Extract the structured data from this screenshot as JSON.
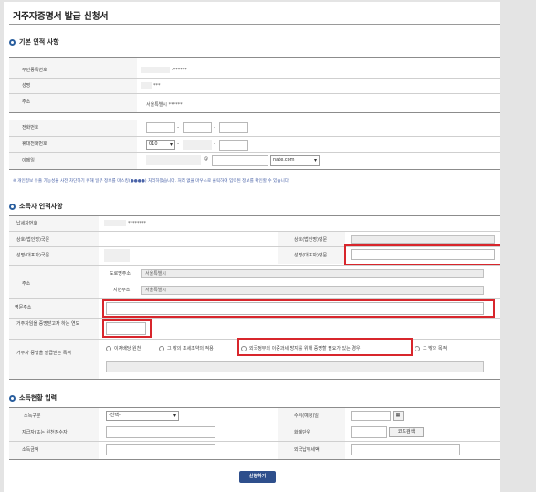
{
  "title": "거주자증명서 발급 신청서",
  "sections": {
    "basic": "기본 인적 사항",
    "income_person": "소득자 인적사항",
    "income_status": "소득현황 입력"
  },
  "basic": {
    "rrn_label": "주민등록번호",
    "rrn_value": "-******",
    "name_label": "성명",
    "name_value": "***",
    "address_label": "주소",
    "address_value": "서울특별시 ******",
    "phone_label": "전화번호",
    "mobile_label": "휴대전화번호",
    "mobile_prefix": "010",
    "email_label": "이메일",
    "email_at": "@",
    "email_domain": "nate.com"
  },
  "note": "※ 개인정보 유출 가능성을 사전 차단하기 위해 일부 정보를 마스킹(●●●●) 처리하였습니다. 처리 없을 마우스로 클릭하여 입력된 정보를 확인할 수 있습니다.",
  "income_person": {
    "tin_label": "납세자번호",
    "tin_value": "********",
    "biz_name_label": "상호(법인명)국문",
    "biz_name_en_label": "상호(법인명)영문",
    "rep_name_label": "성명(대표자)국문",
    "rep_name_en_label": "성명(대표자)영문",
    "address_label": "주소",
    "road_label": "도로명주소",
    "road_value": "서울특별시",
    "lot_label": "지번주소",
    "lot_value": "서울특별시",
    "en_address_label": "영문주소",
    "year_label": "거주자임을 증명받고자 하는 연도",
    "purpose_label": "거주자 증명을 발급받는 목적",
    "purpose_options": [
      "이자배당 원천",
      "그 밖의 조세조약의 적용",
      "외국정부의 이중과세 방지를 위해 증명할 필요가 있는 경우",
      "그 밖의 목적"
    ]
  },
  "income_status": {
    "income_type_label": "소득구분",
    "income_type_value": "-선택-",
    "period_label": "수취(예정)일",
    "payer_label": "지급자(또는 원천징수자)",
    "currency_label": "화폐단위",
    "code_search": "코드검색",
    "amount_label": "소득금액",
    "foreign_tax_label": "외국납부세액"
  },
  "submit_label": "신청하기"
}
